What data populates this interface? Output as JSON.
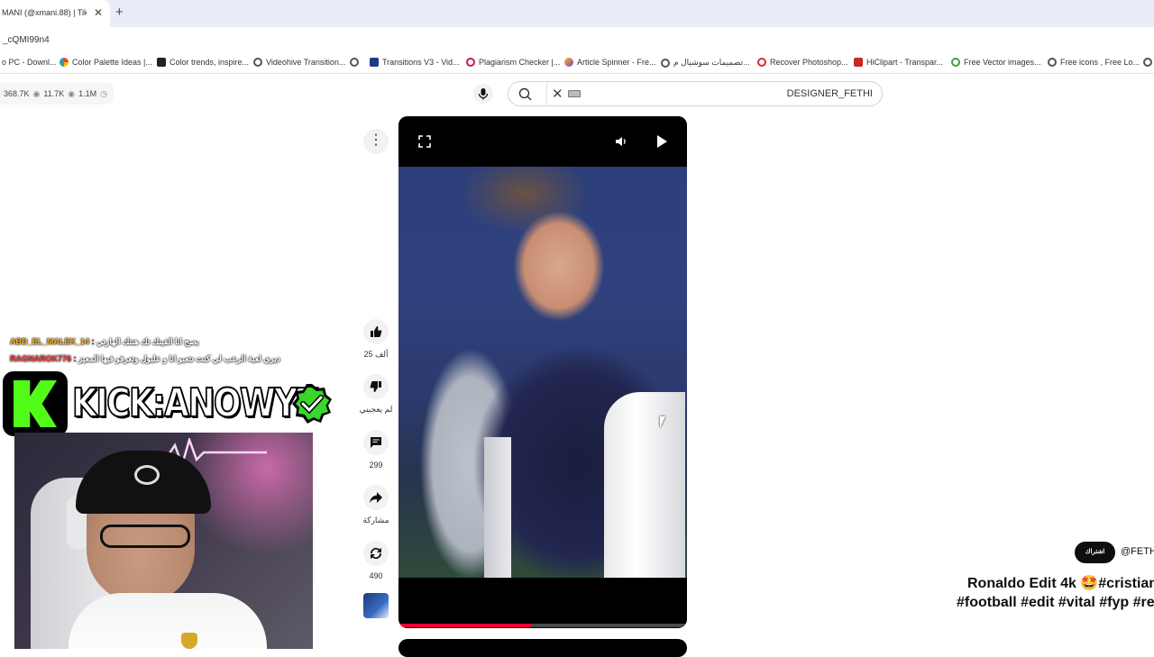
{
  "browser": {
    "tab_title": "MANI (@xmani.88) | TikTo",
    "tab_close": "✕",
    "new_tab": "+",
    "url": "_cQMI99n4",
    "bookmarks": [
      {
        "label": "o PC - Downl...",
        "color": "#888888"
      },
      {
        "label": "Color Palette Ideas |...",
        "color": "#e94235"
      },
      {
        "label": "Color trends, inspire...",
        "color": "#222222"
      },
      {
        "label": "Videohive Transition...",
        "color": "#555555"
      },
      {
        "label": "Transitions V3 - Vid...",
        "color": "#1f3a8a"
      },
      {
        "label": "Plagiarism Checker |...",
        "color": "#c2185b"
      },
      {
        "label": "Article Spinner - Fre...",
        "color": "#7b3fe4"
      },
      {
        "label": "تصميمات سوشيال م...",
        "color": "#555555"
      },
      {
        "label": "Recover Photoshop...",
        "color": "#d32f2f"
      },
      {
        "label": "HiClipart - Transpar...",
        "color": "#c62828"
      },
      {
        "label": "Free Vector images...",
        "color": "#43a047"
      },
      {
        "label": "Free icons , Free Lo...",
        "color": "#555555"
      }
    ]
  },
  "stats": {
    "a": "368.7K",
    "b": "11.7K",
    "c": "1.1M"
  },
  "search": {
    "query": "DESIGNER_FETHI"
  },
  "actions": {
    "more": "⋮",
    "like_count": "25 ألف",
    "dislike_label": "لم يعجبني",
    "comment_count": "299",
    "share_label": "مشاركة",
    "remix_count": "490"
  },
  "player": {
    "progress": 0.46
  },
  "chat": [
    {
      "user": "ABD_EL_MALEK_14",
      "message": "بصح انا الفينك تك هنتك الهارتي",
      "color": "#ffb51e"
    },
    {
      "user": "RAGNAROK776",
      "message": "ديري لعبة الرعب لي كنت نتعبو انا و علبول وتعرفو فيها المعيز",
      "color": "#ff4a4a"
    }
  ],
  "overlay": {
    "kick_text": "KICK:ANOWYT"
  },
  "video": {
    "subscribe": "اشتراك",
    "channel": "@FETH",
    "title": "Ronaldo Edit 4k 🤩#cristian",
    "tags": "#football #edit #vital #fyp #re"
  }
}
